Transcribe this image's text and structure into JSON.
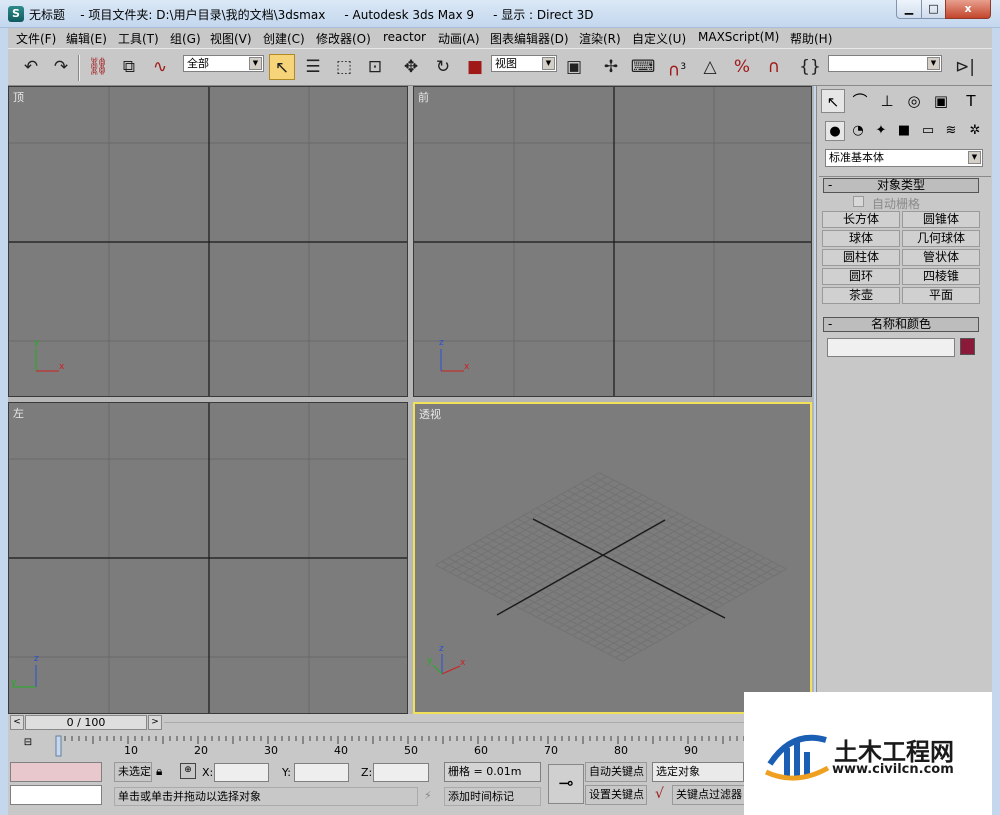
{
  "window": {
    "title": "无标题    - 项目文件夹: D:\\用户目录\\我的文档\\3dsmax     - Autodesk 3ds Max 9     - 显示 : Direct 3D",
    "app_icon": "3dsmax-icon",
    "min_label": "▁",
    "max_label": "□",
    "close_label": "x"
  },
  "menu": [
    "文件(F)",
    "编辑(E)",
    "工具(T)",
    "组(G)",
    "视图(V)",
    "创建(C)",
    "修改器(O)",
    "reactor",
    "动画(A)",
    "图表编辑器(D)",
    "渲染(R)",
    "自定义(U)",
    "MAXScript(M)",
    "帮助(H)"
  ],
  "toolbar": {
    "selection_filter": "全部",
    "ref_coord": "视图",
    "named_selection": "",
    "snap_label": "3",
    "icons": [
      "undo-icon",
      "redo-icon",
      "select-link-icon",
      "unlink-icon",
      "bind-spacewarp-icon",
      "select-object-icon",
      "select-by-name-icon",
      "rect-region-icon",
      "window-crossing-icon",
      "move-icon",
      "rotate-icon",
      "scale-icon",
      "pivot-icon",
      "manipulate-icon",
      "keyboard-shortcut-icon",
      "snap-icon",
      "angle-snap-icon",
      "percent-snap-icon",
      "spinner-snap-icon",
      "edit-named-selection-icon",
      "mirror-icon"
    ]
  },
  "viewports": {
    "top": "顶",
    "front": "前",
    "left": "左",
    "perspective": "透视",
    "axis_x": "x",
    "axis_y": "y",
    "axis_z": "z"
  },
  "command_panel": {
    "tabs": [
      "create-tab-icon",
      "modify-tab-icon",
      "hierarchy-tab-icon",
      "motion-tab-icon",
      "display-tab-icon",
      "utilities-tab-icon"
    ],
    "subtabs": [
      "geometry-icon",
      "shapes-icon",
      "lights-icon",
      "cameras-icon",
      "helpers-icon",
      "spacewarps-icon",
      "systems-icon"
    ],
    "category": "标准基本体",
    "object_type_title": "对象类型",
    "autogrid_label": "自动栅格",
    "buttons": [
      "长方体",
      "圆锥体",
      "球体",
      "几何球体",
      "圆柱体",
      "管状体",
      "圆环",
      "四棱锥",
      "茶壶",
      "平面"
    ],
    "name_color_title": "名称和颜色",
    "object_name": "",
    "object_color": "#8b1a3a"
  },
  "timeline": {
    "slider_label": "0 / 100",
    "prev": "<",
    "next": ">",
    "ticks": [
      "10",
      "20",
      "30",
      "40",
      "50",
      "60",
      "70",
      "80",
      "90"
    ]
  },
  "status": {
    "selection": "未选定",
    "x_label": "X:",
    "y_label": "Y:",
    "z_label": "Z:",
    "x_value": "",
    "y_value": "",
    "z_value": "",
    "grid": "栅格 = 0.01m",
    "auto_key": "自动关键点",
    "selected_object": "选定对象",
    "set_key": "设置关键点",
    "key_filters": "关键点过滤器",
    "prompt": "单击或单击并拖动以选择对象",
    "add_time_tag": "添加时间标记"
  },
  "watermark": {
    "name": "土木工程网",
    "url": "www.civilcn.com"
  }
}
